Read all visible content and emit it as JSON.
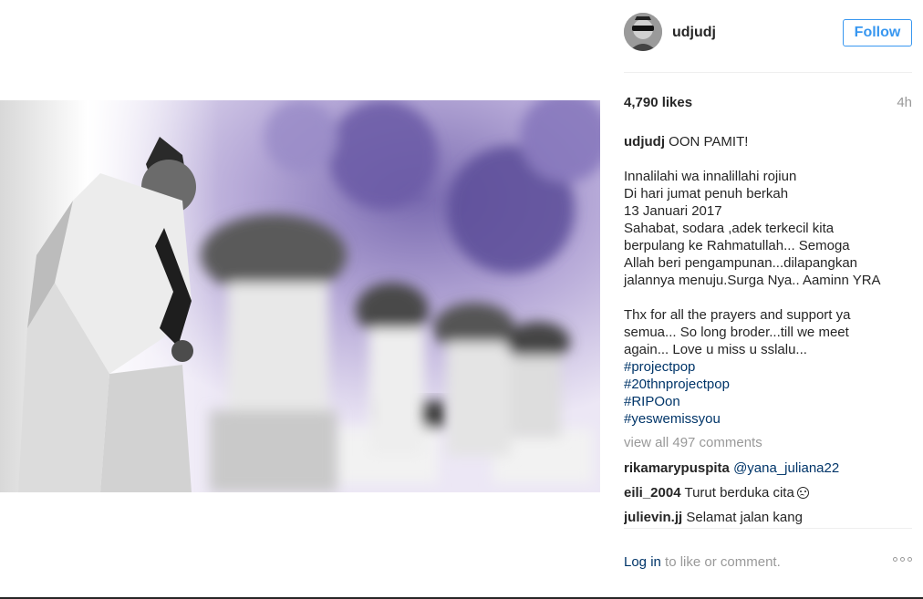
{
  "post": {
    "username": "udjudj",
    "follow_label": "Follow",
    "likes": "4,790 likes",
    "age": "4h",
    "caption": {
      "author": "udjudj",
      "first_line": "OON PAMIT!",
      "lines": [
        "Innalilahi wa innalillahi rojiun",
        "Di hari jumat penuh berkah",
        "13 Januari 2017",
        "Sahabat, sodara ,adek terkecil kita",
        "berpulang ke Rahmatullah... Semoga",
        "Allah beri pengampunan...dilapangkan",
        "jalannya menuju.Surga Nya.. Aaminn YRA"
      ],
      "lines2": [
        "Thx for all the prayers and support ya",
        "semua... So long broder...till we meet",
        "again... Love u miss u sslalu..."
      ],
      "hashtags": [
        "#projectpop",
        "#20thnprojectpop",
        "#RIPOon",
        "#yeswemissyou"
      ]
    },
    "view_all": "view all 497 comments",
    "comments": [
      {
        "user": "rikamarypuspita",
        "text": "@yana_juliana22"
      },
      {
        "user": "eili_2004",
        "text": "Turut berduka cita"
      },
      {
        "user": "julievin.jj",
        "text": "Selamat jalan kang"
      }
    ],
    "footer": {
      "login_link": "Log in",
      "login_rest": "to like or comment."
    },
    "icons": {
      "avatar": "profile-avatar",
      "more": "more-options-icon",
      "emoji": "frowning-face-icon"
    },
    "colors": {
      "accent": "#3897f0",
      "link": "#003569",
      "muted": "#999999"
    }
  }
}
